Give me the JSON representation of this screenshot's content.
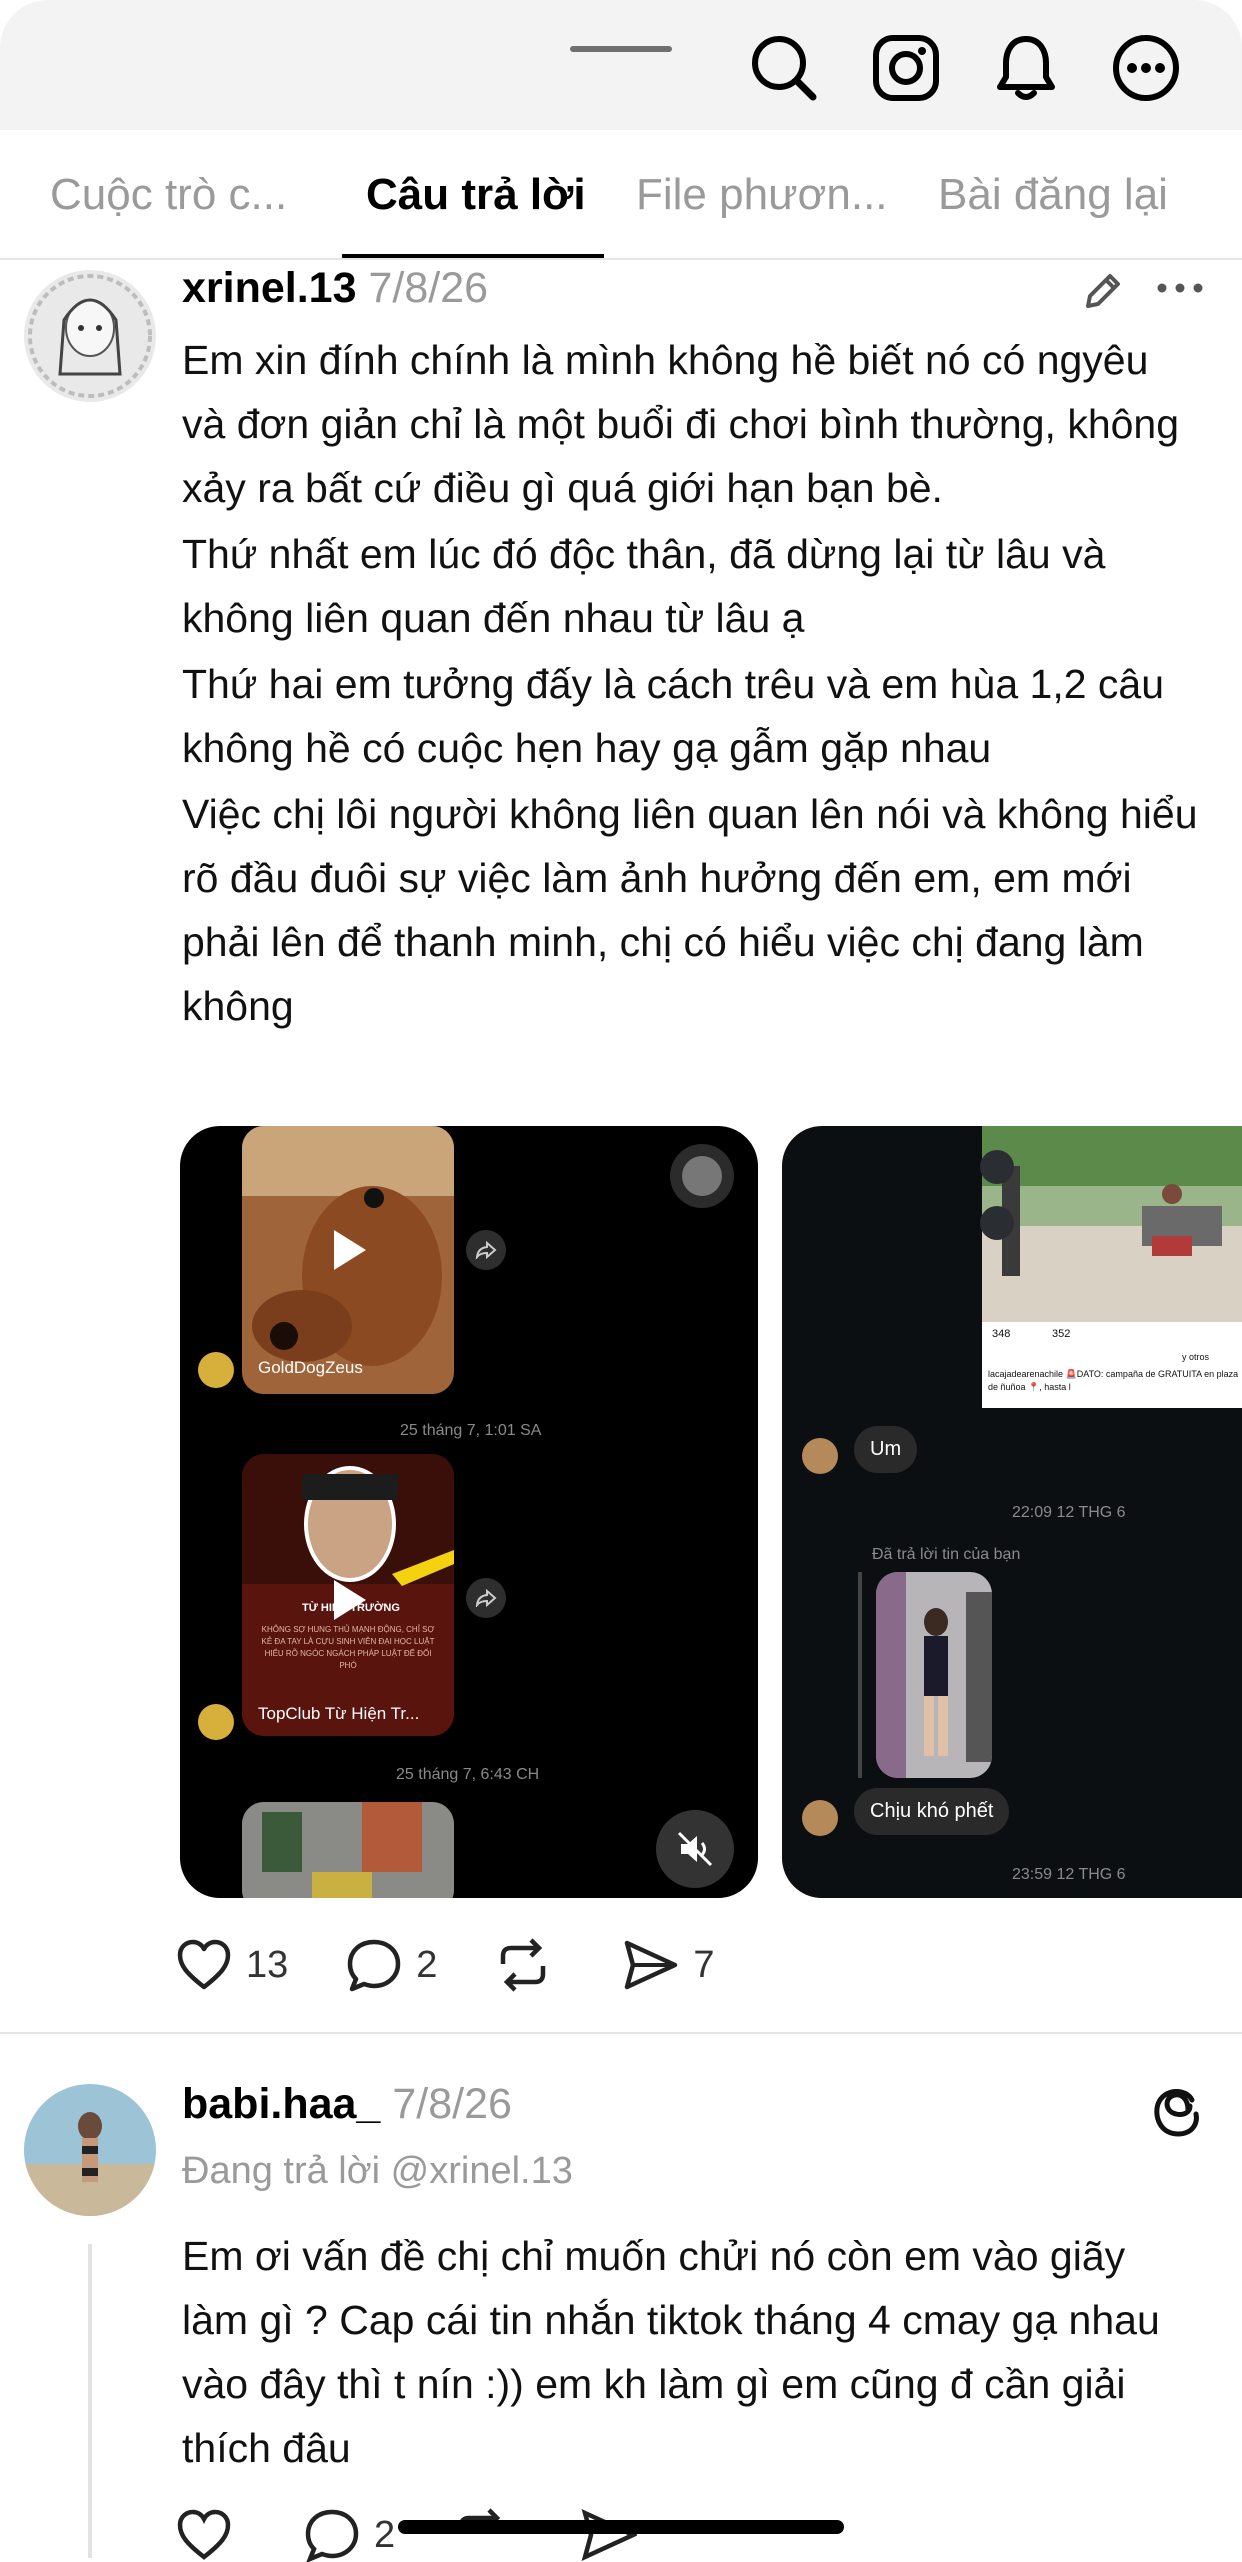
{
  "tabs": [
    {
      "label": "Cuộc trò c..."
    },
    {
      "label": "Câu trả lời"
    },
    {
      "label": "File phươn..."
    },
    {
      "label": "Bài đăng lại"
    }
  ],
  "post1": {
    "username": "xrinel.13",
    "date": "7/8/26",
    "paragraphs": [
      "Em xin đính chính là mình không hề biết nó có ngyêu và đơn giản chỉ là một buổi đi chơi bình thường, không xảy ra bất cứ điều gì quá giới hạn bạn bè.",
      "Thứ nhất em lúc đó độc thân, đã dừng lại từ lâu và không liên quan đến nhau từ lâu ạ",
      "Thứ hai em tưởng đấy là cách trêu và em hùa 1,2 câu không hề có cuộc hẹn hay gạ gẫm gặp nhau",
      "Việc chị lôi người không liên quan lên nói và không hiểu rõ đầu đuôi sự việc làm ảnh hưởng đến em, em mới phải lên để thanh minh, chị có hiểu việc chị đang làm không"
    ],
    "likes": "13",
    "replies": "2",
    "shares": "7",
    "image1": {
      "video1_channel": "GoldDogZeus",
      "timestamp1": "25 tháng 7, 1:01 SA",
      "video2_title": "TỪ HIỆN TRƯỜNG",
      "video2_caption": "KHÔNG SỢ HUNG THỦ MẠNH ĐỘNG, CHỈ SỢ KẺ ĐA TAY LÀ CỰU SINH VIÊN ĐẠI HỌC LUẬT HIỂU RÕ NGÓC NGÁCH PHÁP LUẬT ĐỂ ĐỐI PHÓ",
      "video2_channel": "TopClub Từ Hiện Tr...",
      "timestamp2": "25 tháng 7, 6:43 CH"
    },
    "image2": {
      "post_likes": "348",
      "post_reshares": "352",
      "post_others": "y otros",
      "post_caption": "lacajadearenachile 🚨DATO: campaña de GRATUITA en plaza de ñuñoa 📍, hasta l",
      "msg1": "Um",
      "time1": "22:09 12 THG 6",
      "reply_label": "Đã trả lời tin của bạn",
      "msg2": "Chịu khó phết",
      "time2": "23:59 12 THG 6"
    }
  },
  "post2": {
    "username": "babi.haa_",
    "date": "7/8/26",
    "replying_to": "Đang trả lời @xrinel.13",
    "text": "Em ơi vấn đề chị chỉ muốn chửi nó còn em vào giãy làm gì ? Cap cái tin nhắn tiktok tháng 4 cmay gạ nhau vào đây thì t nín :)) em kh làm gì em cũng đ cần giải thích đâu",
    "replies": "2"
  },
  "icons": {
    "header": [
      "search-icon",
      "instagram-icon",
      "bell-icon",
      "more-icon"
    ],
    "post_actions": [
      "heart-icon",
      "comment-icon",
      "repost-icon",
      "share-icon"
    ]
  }
}
